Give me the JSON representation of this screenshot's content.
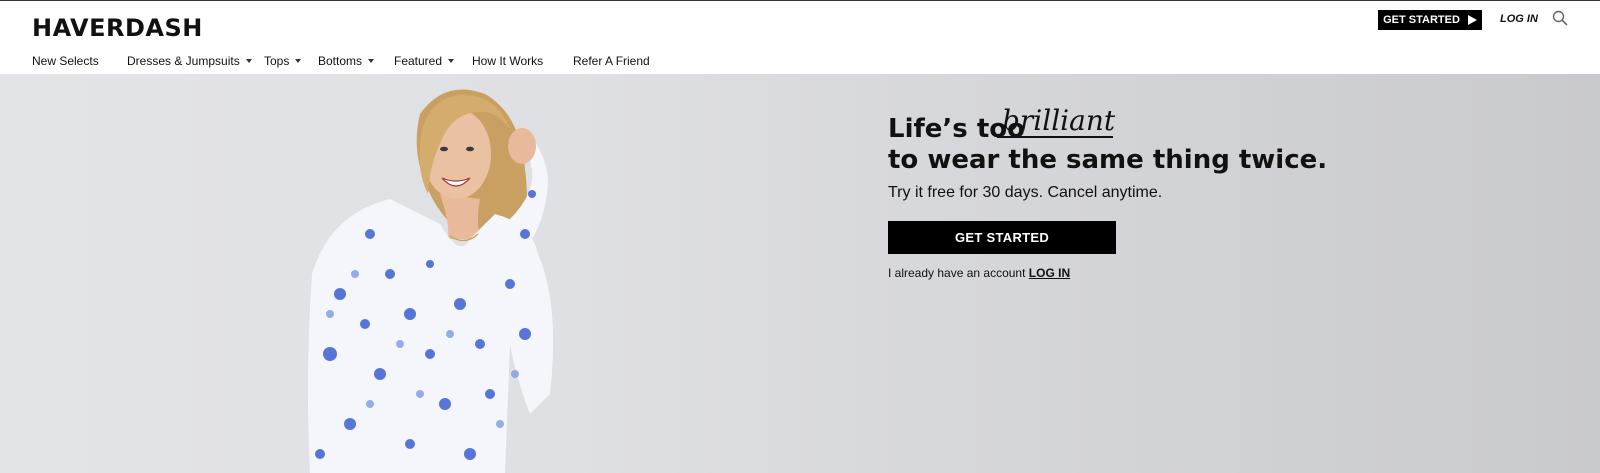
{
  "brand": {
    "logo_text": "HAVERDASH"
  },
  "header": {
    "get_started_label": "GET STARTED",
    "login_label": "LOG IN",
    "search_icon": "search-icon"
  },
  "nav": {
    "items": [
      {
        "label": "New Selects",
        "has_dropdown": false
      },
      {
        "label": "Dresses & Jumpsuits",
        "has_dropdown": true
      },
      {
        "label": "Tops",
        "has_dropdown": true
      },
      {
        "label": "Bottoms",
        "has_dropdown": true
      },
      {
        "label": "Featured",
        "has_dropdown": true
      },
      {
        "label": "How It Works",
        "has_dropdown": false
      },
      {
        "label": "Refer A Friend",
        "has_dropdown": false
      }
    ]
  },
  "hero": {
    "headline_prefix": "Life’s too",
    "headline_script": "brilliant",
    "headline_line2": "to wear the same thing twice.",
    "subline": "Try it free for 30 days. Cancel anytime.",
    "cta_label": "GET STARTED",
    "account_text": "I already have an account",
    "account_link": "LOG IN"
  },
  "colors": {
    "button_bg": "#000000",
    "button_text": "#ffffff",
    "hero_bg": "#dfe0e3",
    "dress_blue": "#3b5fd0"
  }
}
